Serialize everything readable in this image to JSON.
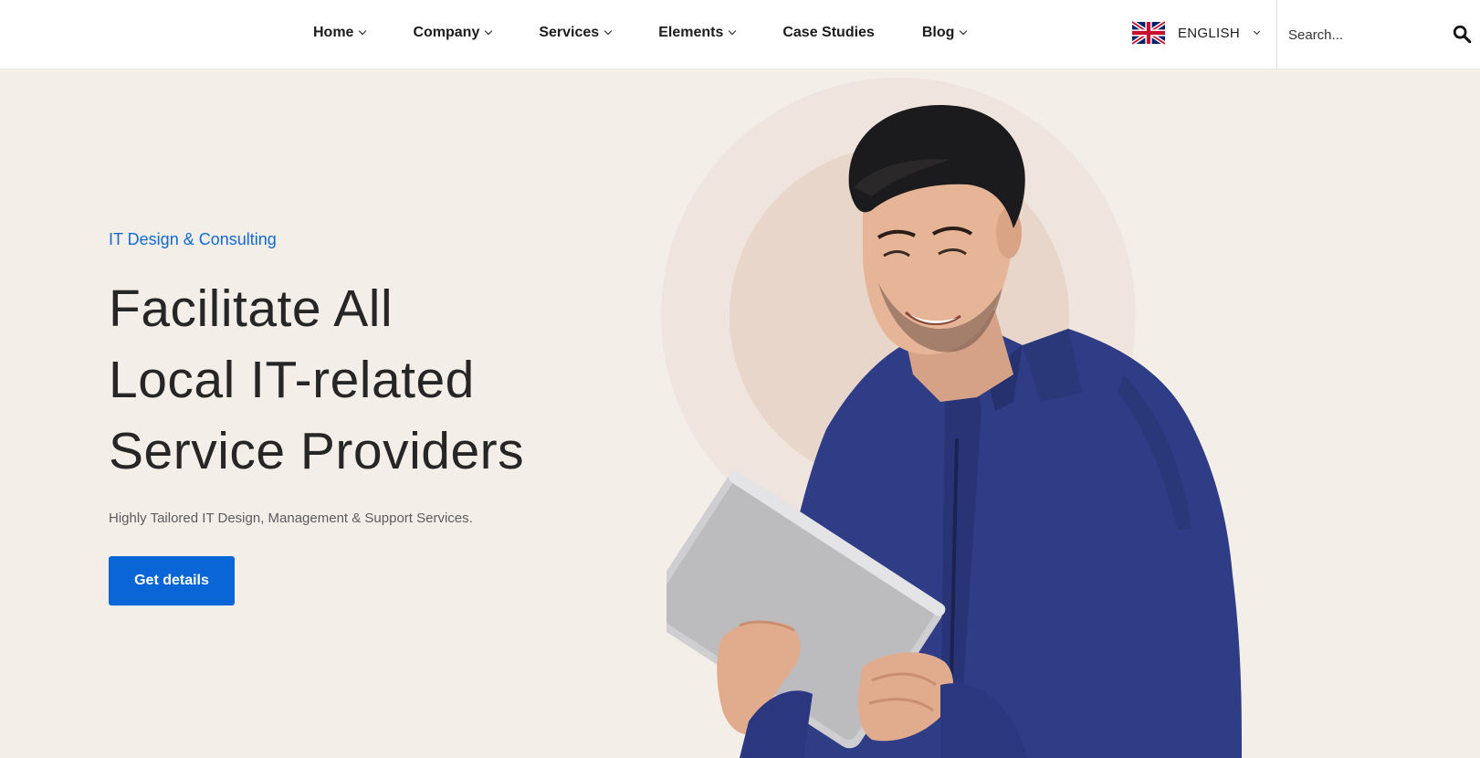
{
  "header": {
    "nav": [
      {
        "label": "Home",
        "has_dropdown": true
      },
      {
        "label": "Company",
        "has_dropdown": true
      },
      {
        "label": "Services",
        "has_dropdown": true
      },
      {
        "label": "Elements",
        "has_dropdown": true
      },
      {
        "label": "Case Studies",
        "has_dropdown": false
      },
      {
        "label": "Blog",
        "has_dropdown": true
      }
    ],
    "language": {
      "label": "ENGLISH",
      "flag": "uk-flag-icon"
    },
    "search": {
      "placeholder": "Search...",
      "icon": "search-icon"
    }
  },
  "hero": {
    "eyebrow": "IT Design & Consulting",
    "headline_lines": [
      "Facilitate All",
      "Local IT-related",
      "Service Providers"
    ],
    "subtitle": "Highly Tailored IT Design, Management & Support Services.",
    "cta_label": "Get details"
  },
  "colors": {
    "accent": "#0a66d6",
    "hero_bg": "#f4eee8",
    "shirt": "#2f3c86",
    "headline": "#262626"
  }
}
